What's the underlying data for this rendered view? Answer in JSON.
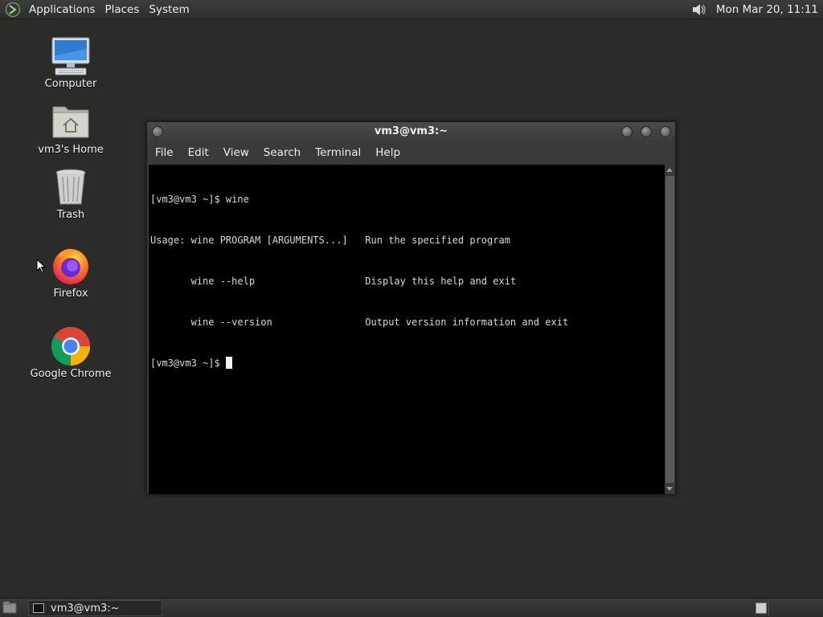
{
  "top_panel": {
    "menus": [
      "Applications",
      "Places",
      "System"
    ],
    "clock": "Mon Mar 20, 11:11",
    "icons": {
      "logo": "distro-logo-icon",
      "volume": "volume-icon"
    }
  },
  "desktop": {
    "icons": [
      {
        "label": "Computer",
        "icon": "computer-icon"
      },
      {
        "label": "vm3's Home",
        "icon": "home-folder-icon"
      },
      {
        "label": "Trash",
        "icon": "trash-icon"
      },
      {
        "label": "Firefox",
        "icon": "firefox-icon"
      },
      {
        "label": "Google Chrome",
        "icon": "chrome-icon"
      }
    ]
  },
  "terminal": {
    "title": "vm3@vm3:~",
    "menu": [
      "File",
      "Edit",
      "View",
      "Search",
      "Terminal",
      "Help"
    ],
    "lines": [
      "[vm3@vm3 ~]$ wine",
      "Usage: wine PROGRAM [ARGUMENTS...]   Run the specified program",
      "       wine --help                   Display this help and exit",
      "       wine --version                Output version information and exit"
    ],
    "prompt": "[vm3@vm3 ~]$ "
  },
  "bottom_panel": {
    "task_label": "vm3@vm3:~"
  },
  "colors": {
    "desktop_bg": "#2b2c2a",
    "panel_bg": "#353633",
    "terminal_bg": "#000000",
    "terminal_fg": "#d8d8d8"
  }
}
